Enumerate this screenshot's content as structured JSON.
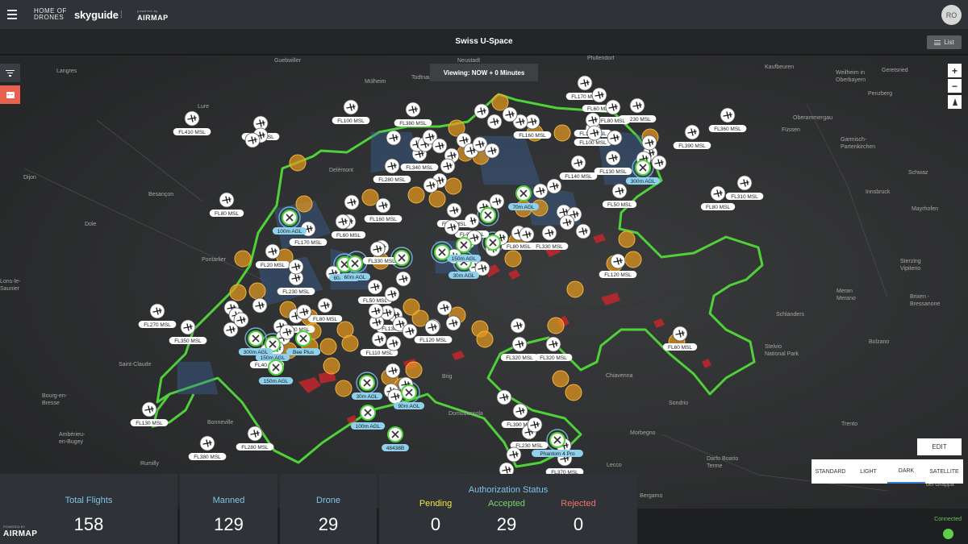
{
  "header": {
    "brand_home": "HOME OF DRONES",
    "brand_skyguide": "skyguide",
    "brand_powered": "powered by",
    "brand_airmap": "AIRMAP",
    "avatar_initials": "RO"
  },
  "titlebar": {
    "title": "Swiss U-Space",
    "list_label": "List"
  },
  "map": {
    "viewing_label": "Viewing: NOW + 0 Minutes",
    "zoom_in": "+",
    "zoom_out": "−",
    "edit_label": "EDIT",
    "styles": [
      "STANDARD",
      "LIGHT",
      "DARK",
      "SATELLITE"
    ],
    "active_style": "DARK",
    "colors": {
      "border": "#4fd13a",
      "zone": "#e89a1e",
      "restricted": "#c1272d",
      "airspace": "#3a6db0",
      "drone_label": "#8fd0ec"
    },
    "places": [
      {
        "name": "Guebwiller"
      },
      {
        "name": "Neustadt"
      },
      {
        "name": "Pfullendorf"
      },
      {
        "name": "Kaufbeuren"
      },
      {
        "name": "Weilheim in Oberbayern"
      },
      {
        "name": "Geretsried"
      },
      {
        "name": "Penzberg"
      },
      {
        "name": "Oberammergau"
      },
      {
        "name": "Füssen"
      },
      {
        "name": "Garmisch-Partenkirchen"
      },
      {
        "name": "Schwaz"
      },
      {
        "name": "Innsbruck"
      },
      {
        "name": "Mayrhofen"
      },
      {
        "name": "Sterzing Vipiteno"
      },
      {
        "name": "Brixen - Bressanone"
      },
      {
        "name": "Bolzano"
      },
      {
        "name": "Meran Merano"
      },
      {
        "name": "Schlanders"
      },
      {
        "name": "Stelvio National Park"
      },
      {
        "name": "Trento"
      },
      {
        "name": "Sondrio"
      },
      {
        "name": "Chiavenna"
      },
      {
        "name": "Morbegno"
      },
      {
        "name": "Lecco"
      },
      {
        "name": "Bergamo"
      },
      {
        "name": "Darfo Boario Terme"
      },
      {
        "name": "del Grappa"
      },
      {
        "name": "Mülheim"
      },
      {
        "name": "Todtnau"
      },
      {
        "name": "Lure"
      },
      {
        "name": "Dijon"
      },
      {
        "name": "Besançon"
      },
      {
        "name": "Dole"
      },
      {
        "name": "Pontarlier"
      },
      {
        "name": "Lons-le-Saunier"
      },
      {
        "name": "Saint-Claude"
      },
      {
        "name": "Bourg-en-Bresse"
      },
      {
        "name": "Ambérieu-en-Bugey"
      },
      {
        "name": "Bonneville"
      },
      {
        "name": "Rumilly"
      },
      {
        "name": "Delémont"
      },
      {
        "name": "Brig"
      },
      {
        "name": "Domodossola"
      },
      {
        "name": "Langres"
      }
    ],
    "flight_labels": [
      "FL410 MSL",
      "FL100 MSL",
      "FL180 MSL",
      "FL380 MSL",
      "FL80 MSL",
      "FL270 MSL",
      "FL350 MSL",
      "FL130 MSL",
      "FL380 MSL",
      "FL280 MSL",
      "FL160 MSL",
      "FL60 MSL",
      "FL20 MSL",
      "FL170 MSL",
      "FL230 MSL",
      "FL80 MSL",
      "FL390 MSL",
      "FL40 MSL",
      "FL330 MSL",
      "FL50 MSL",
      "FL110 MSL",
      "FL120 MSL",
      "FL130 MSL",
      "FL340 MSL",
      "FL280 MSL",
      "FL30 MSL",
      "FL90 MSL",
      "FL80 MSL",
      "FL330 MSL",
      "FL100 MSL",
      "FL140 MSL",
      "FL130 MSL",
      "FL50 MSL",
      "FL120 MSL",
      "FL320 MSL",
      "FL320 MSL",
      "FL60 MSL",
      "FL390 MSL",
      "FL230 MSL",
      "FL370 MSL",
      "FL170 MSL",
      "FL60 MSL",
      "FL230 MSL",
      "FL80 MSL",
      "FL360 MSL",
      "FL390 MSL",
      "FL310 MSL",
      "FL80 MSL",
      "FL160 MSL",
      "FL100 MSL"
    ],
    "drone_labels": [
      "100m AGL",
      "60m AGL",
      "150m AGL",
      "300m AGL",
      "150m AGL",
      "30m AGL",
      "90m AGL",
      "100m AGL",
      "60m AGL",
      "30m AGL",
      "70m AGL",
      "300m AGL",
      "150m AGL",
      "Phantom 4 Pro",
      "Bee Plus",
      "48438B"
    ]
  },
  "stats": {
    "total_flights": {
      "label": "Total Flights",
      "value": "158"
    },
    "manned": {
      "label": "Manned",
      "value": "129"
    },
    "drone": {
      "label": "Drone",
      "value": "29"
    },
    "authorization": {
      "title": "Authorization Status",
      "pending": {
        "label": "Pending",
        "value": "0",
        "color": "#f2e93b"
      },
      "accepted": {
        "label": "Accepted",
        "value": "29",
        "color": "#7bd36a"
      },
      "rejected": {
        "label": "Rejected",
        "value": "0",
        "color": "#f07465"
      }
    }
  },
  "footer": {
    "powered": "POWERED BY",
    "airmap": "AIRMAP",
    "connection_status": "Connected"
  }
}
